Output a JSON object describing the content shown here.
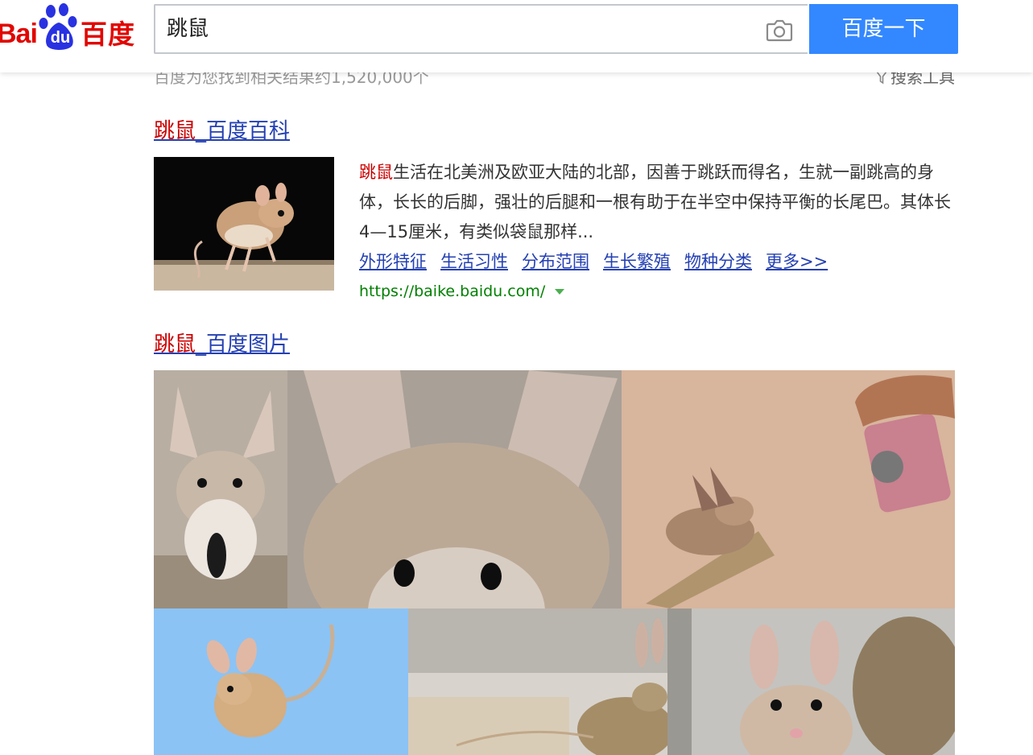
{
  "header": {
    "logo": {
      "bai": "Bai",
      "du": "du",
      "cn": "百度"
    },
    "search": {
      "query": "跳鼠"
    },
    "button_label": "百度一下",
    "camera_icon": "camera-icon"
  },
  "results_info": {
    "count": "百度为您找到相关结果约1,520,000个",
    "tools": "搜索工具"
  },
  "result1": {
    "title_keyword": "跳鼠",
    "title_rest": "_百度百科",
    "abstract_keyword": "跳鼠",
    "abstract_rest": "生活在北美洲及欧亚大陆的北部，因善于跳跃而得名，生就一副跳高的身体，长长的后脚，强壮的后腿和一根有助于在半空中保持平衡的长尾巴。其体长4—15厘米，有类似袋鼠那样...",
    "links": [
      "外形特征",
      "生活习性",
      "分布范围",
      "生长繁殖",
      "物种分类",
      "更多>>"
    ],
    "url": "https://baike.baidu.com/"
  },
  "result2": {
    "title_keyword": "跳鼠",
    "title_rest": "_百度图片"
  },
  "colors": {
    "brand_red": "#e10601",
    "brand_blue": "#2932e1",
    "button_blue": "#3388ff",
    "link_blue": "#2440b3",
    "keyword_red": "#cc0000",
    "url_green": "#008000"
  }
}
